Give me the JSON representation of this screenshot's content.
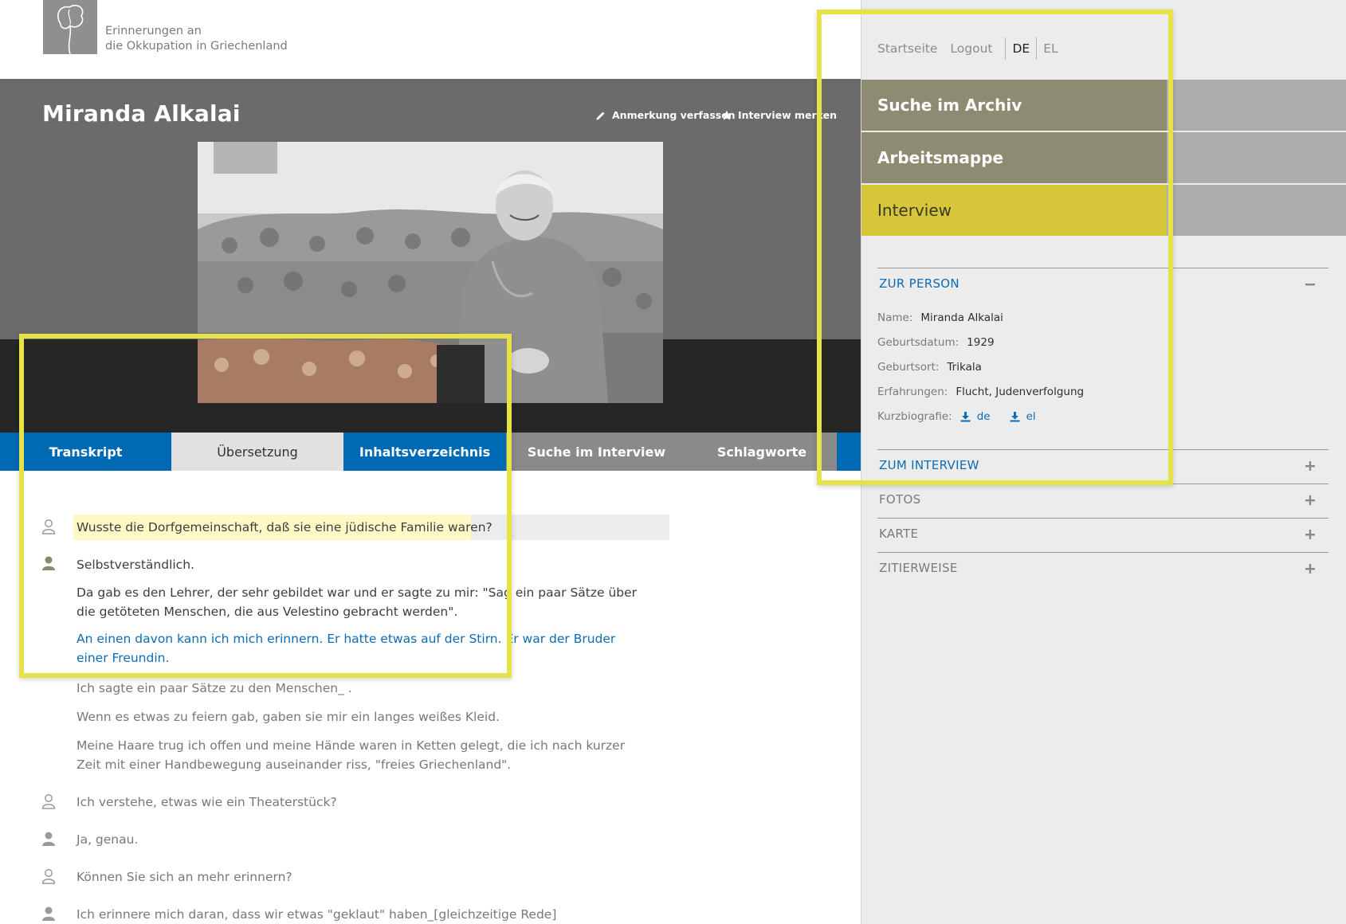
{
  "site": {
    "title_line1": "Erinnerungen an",
    "title_line2": "die Okkupation in Griechenland"
  },
  "header": {
    "interviewee_name": "Miranda Alkalai",
    "actions": {
      "annotate": "Anmerkung verfassen",
      "bookmark": "Interview merken"
    }
  },
  "tabs": [
    {
      "label": "Transkript"
    },
    {
      "label": "Übersetzung"
    },
    {
      "label": "Inhaltsverzeichnis"
    },
    {
      "label": "Suche im Interview"
    },
    {
      "label": "Schlagworte"
    }
  ],
  "transcript": [
    {
      "speaker": "interviewer",
      "text": "Wusste die Dorfgemeinschaft, daß sie eine jüdische Familie waren?"
    },
    {
      "speaker": "interviewee",
      "text": "Selbstverständlich."
    },
    {
      "speaker": "",
      "text": "Da gab es den Lehrer, der sehr gebildet war und er sagte zu mir: \"Sag ein paar Sätze über die getöteten Menschen, die aus Velestino gebracht werden\"."
    },
    {
      "speaker": "",
      "text": "An einen davon kann ich mich erinnern. Er hatte etwas auf der Stirn. Er war der Bruder einer Freundin."
    },
    {
      "speaker": "",
      "text": "Ich sagte ein paar Sätze zu den Menschen_ ."
    },
    {
      "speaker": "",
      "text": "Wenn es etwas zu feiern gab, gaben sie mir ein langes weißes Kleid."
    },
    {
      "speaker": "",
      "text": "Meine Haare trug ich offen und meine Hände waren in Ketten gelegt, die ich nach kurzer Zeit mit einer Handbewegung auseinander riss, \"freies Griechenland\"."
    },
    {
      "speaker": "interviewer",
      "text": "Ich verstehe, etwas wie ein Theaterstück?"
    },
    {
      "speaker": "interviewee",
      "text": "Ja, genau."
    },
    {
      "speaker": "interviewer",
      "text": "Können Sie sich an mehr erinnern?"
    },
    {
      "speaker": "interviewee",
      "text": "Ich erinnere mich daran, dass wir etwas \"geklaut\" haben_[gleichzeitige Rede]"
    }
  ],
  "sidebar": {
    "nav": {
      "home": "Startseite",
      "logout": "Logout",
      "lang_de": "DE",
      "lang_el": "EL"
    },
    "menu": [
      {
        "label": "Suche im Archiv"
      },
      {
        "label": "Arbeitsmappe"
      },
      {
        "label": "Interview"
      }
    ],
    "sections": {
      "person": {
        "title": "ZUR PERSON",
        "name_label": "Name:",
        "name_value": "Miranda Alkalai",
        "birthdate_label": "Geburtsdatum:",
        "birthdate_value": "1929",
        "birthplace_label": "Geburtsort:",
        "birthplace_value": "Trikala",
        "experiences_label": "Erfahrungen:",
        "experiences_value": "Flucht, Judenverfolgung",
        "biography_label": "Kurzbiografie:",
        "biography_de": "de",
        "biography_el": "el"
      },
      "interview": {
        "title": "ZUM INTERVIEW"
      },
      "photos": {
        "title": "FOTOS"
      },
      "map": {
        "title": "KARTE"
      },
      "citation": {
        "title": "ZITIERWEISE"
      }
    }
  },
  "colors": {
    "blue": "#0069b4",
    "olive": "#8d8b72",
    "yellow": "#d7c63a",
    "annotation": "#e6e34a"
  }
}
